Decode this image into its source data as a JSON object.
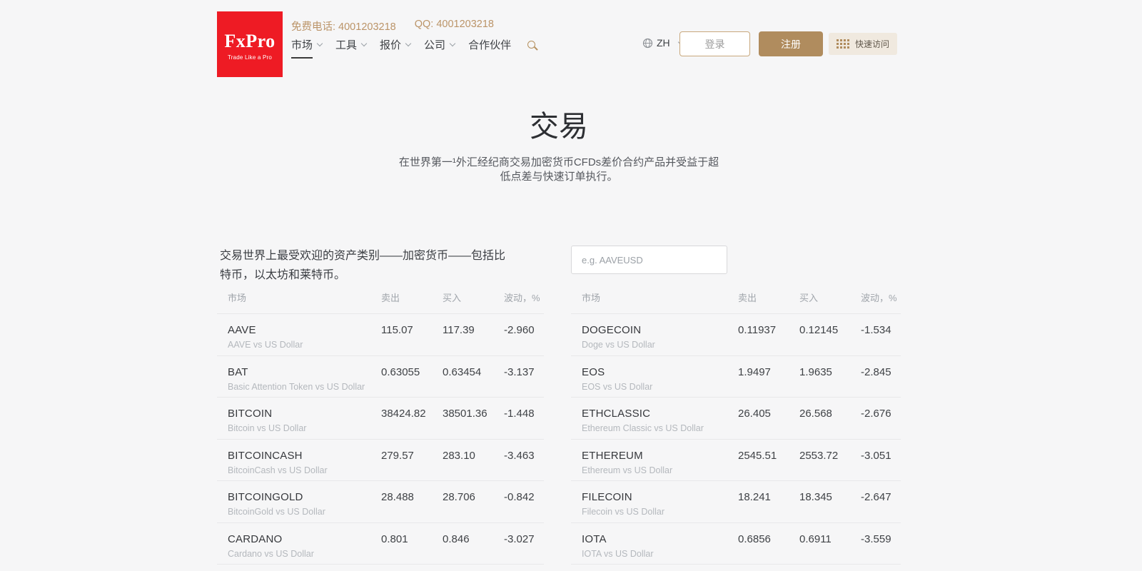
{
  "colors": {
    "brand_red": "#ee1b24",
    "accent_tan": "#b08c5e",
    "page_background": "#f6f6f7"
  },
  "icons": {
    "nav_search": "magnifier-gold",
    "language": "globe",
    "quick_access": "dots-grid-3x4",
    "dropdown": "chevron-down"
  },
  "header": {
    "logo": {
      "title": "FxPro",
      "tagline": "Trade Like a Pro"
    },
    "phone": "免费电话: 4001203218",
    "qq": "QQ: 4001203218",
    "nav_items": [
      {
        "label": "市场"
      },
      {
        "label": "工具"
      },
      {
        "label": "报价"
      },
      {
        "label": "公司"
      },
      {
        "label": "合作伙伴"
      }
    ],
    "language": "ZH",
    "login": "登录",
    "register": "注册",
    "quick_access": "快速访问"
  },
  "hero": {
    "title": "交易",
    "subtitle": "在世界第一¹外汇经纪商交易加密货币CFDs差价合约产品并受益于超低点差与快速订单执行。"
  },
  "intro_text": "交易世界上最受欢迎的资产类别——加密货币——包括比特币，以太坊和莱特币。",
  "search": {
    "placeholder": "e.g. AAVEUSD"
  },
  "table_headers": {
    "market": "市场",
    "sell": "卖出",
    "buy": "买入",
    "change": "波动，%"
  },
  "tables": {
    "left": {
      "rows": [
        {
          "name": "AAVE",
          "description": "AAVE vs US Dollar",
          "sell": "115.07",
          "buy": "117.39",
          "change": "-2.960"
        },
        {
          "name": "BAT",
          "description": "Basic Attention Token vs US Dollar",
          "sell": "0.63055",
          "buy": "0.63454",
          "change": "-3.137"
        },
        {
          "name": "BITCOIN",
          "description": "Bitcoin vs US Dollar",
          "sell": "38424.82",
          "buy": "38501.36",
          "change": "-1.448"
        },
        {
          "name": "BITCOINCASH",
          "description": "BitcoinCash vs US Dollar",
          "sell": "279.57",
          "buy": "283.10",
          "change": "-3.463"
        },
        {
          "name": "BITCOINGOLD",
          "description": "BitcoinGold vs US Dollar",
          "sell": "28.488",
          "buy": "28.706",
          "change": "-0.842"
        },
        {
          "name": "CARDANO",
          "description": "Cardano vs US Dollar",
          "sell": "0.801",
          "buy": "0.846",
          "change": "-3.027"
        }
      ]
    },
    "right": {
      "rows": [
        {
          "name": "DOGECOIN",
          "description": "Doge vs US Dollar",
          "sell": "0.11937",
          "buy": "0.12145",
          "change": "-1.534"
        },
        {
          "name": "EOS",
          "description": "EOS vs US Dollar",
          "sell": "1.9497",
          "buy": "1.9635",
          "change": "-2.845"
        },
        {
          "name": "ETHCLASSIC",
          "description": "Ethereum Classic vs US Dollar",
          "sell": "26.405",
          "buy": "26.568",
          "change": "-2.676"
        },
        {
          "name": "ETHEREUM",
          "description": "Ethereum vs US Dollar",
          "sell": "2545.51",
          "buy": "2553.72",
          "change": "-3.051"
        },
        {
          "name": "FILECOIN",
          "description": "Filecoin vs US Dollar",
          "sell": "18.241",
          "buy": "18.345",
          "change": "-2.647"
        },
        {
          "name": "IOTA",
          "description": "IOTA vs US Dollar",
          "sell": "0.6856",
          "buy": "0.6911",
          "change": "-3.559"
        }
      ]
    }
  }
}
